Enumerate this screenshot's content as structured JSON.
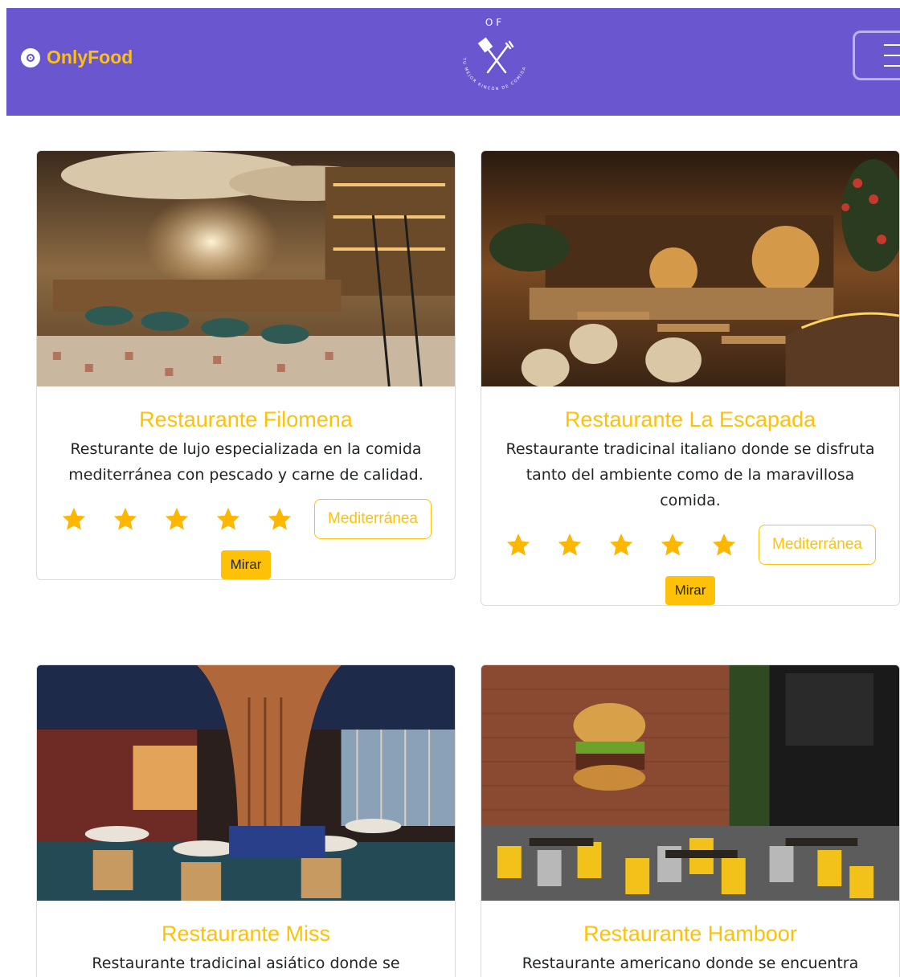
{
  "navbar": {
    "brand_name": "OnlyFood",
    "logo_text_top": "OF",
    "logo_text_arc": "TU MEJOR RINCÓN DE COMIDA",
    "background_color": "#6a56cf",
    "accent_color": "#ffc107"
  },
  "cards": [
    {
      "title": "Restaurante Filomena",
      "description": "Resturante de lujo especializada en la comida mediterránea con pescado y carne de calidad.",
      "rating": 5,
      "cuisine_tag": "Mediterránea",
      "button_label": "Mirar",
      "image_icon": "restaurant-bar-photo"
    },
    {
      "title": "Restaurante La Escapada",
      "description": "Restaurante tradicinal italiano donde se disfruta tanto del ambiente como de la maravillosa comida.",
      "rating": 5,
      "cuisine_tag": "Mediterránea",
      "button_label": "Mirar",
      "image_icon": "restaurant-dining-room-photo"
    },
    {
      "title": "Restaurante Miss",
      "description": "Restaurante tradicinal asiático donde se",
      "image_icon": "restaurant-asian-interior-photo"
    },
    {
      "title": "Restaurante Hamboor",
      "description": "Restaurante americano donde se encuentra",
      "image_icon": "restaurant-burger-wall-photo"
    }
  ]
}
